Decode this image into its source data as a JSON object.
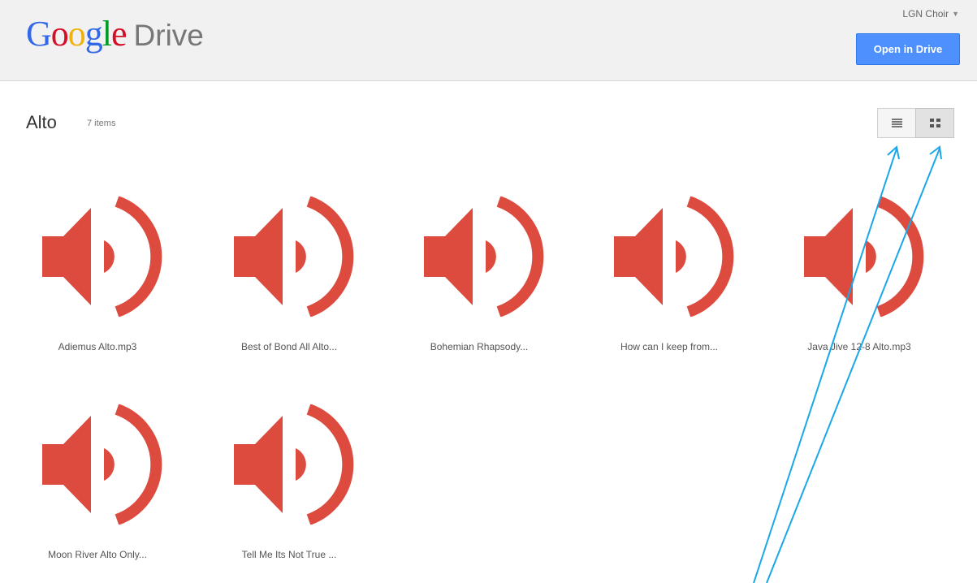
{
  "header": {
    "logo_google": "Google",
    "logo_drive": "Drive",
    "account_name": "LGN Choir",
    "open_button_label": "Open in Drive"
  },
  "folder": {
    "title": "Alto",
    "count": "7 items"
  },
  "view": {
    "list_icon": "list-view-icon",
    "grid_icon": "grid-view-icon",
    "active": "grid"
  },
  "files": [
    {
      "name": "Adiemus Alto.mp3",
      "icon": "audio-speaker-icon"
    },
    {
      "name": "Best of Bond All Alto...",
      "icon": "audio-speaker-icon"
    },
    {
      "name": "Bohemian Rhapsody...",
      "icon": "audio-speaker-icon"
    },
    {
      "name": "How can I keep from...",
      "icon": "audio-speaker-icon"
    },
    {
      "name": "Java Jive 12-8 Alto.mp3",
      "icon": "audio-speaker-icon"
    },
    {
      "name": "Moon River Alto Only...",
      "icon": "audio-speaker-icon"
    },
    {
      "name": "Tell Me Its Not True ...",
      "icon": "audio-speaker-icon"
    }
  ],
  "colors": {
    "audio_icon": "#dc4b3e",
    "primary_button": "#4d90fe",
    "annotation_arrow": "#1aa7e8"
  }
}
